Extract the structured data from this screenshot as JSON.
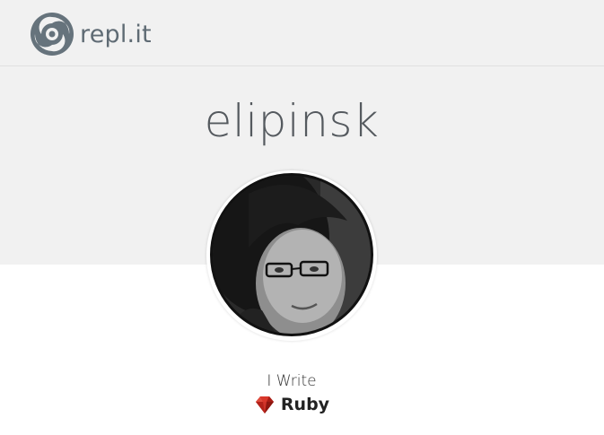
{
  "header": {
    "logo_text": "repl.it",
    "logo_icon": "replit-swirl-icon"
  },
  "profile": {
    "username": "elipinsk",
    "avatar_icon": "user-avatar",
    "writes_label": "I Write",
    "language": {
      "name": "Ruby",
      "icon": "ruby-gem-icon",
      "color": "#c0261d"
    }
  },
  "colors": {
    "background": "#f1f1f1",
    "logo": "#5f6b74",
    "username": "#555a5f"
  }
}
